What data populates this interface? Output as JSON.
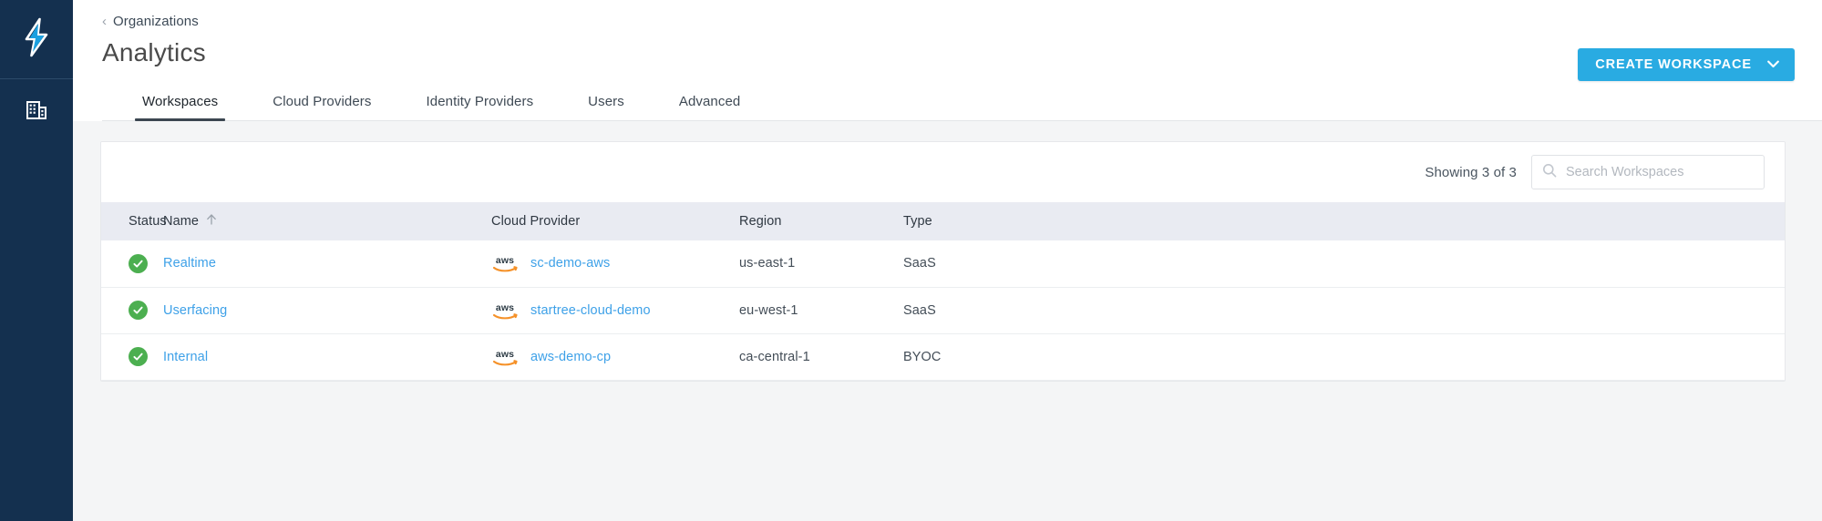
{
  "sidebar": {
    "logo_icon": "startree-lightning-bolt-logo",
    "items": [
      {
        "icon": "organization-building-icon",
        "label": "Organizations"
      }
    ]
  },
  "header": {
    "breadcrumb": {
      "icon": "chevron-left-icon",
      "label": "Organizations"
    },
    "title": "Analytics",
    "create_button": {
      "label": "CREATE WORKSPACE",
      "icon": "chevron-down-icon",
      "color": "#29ABE2"
    }
  },
  "tabs": [
    {
      "label": "Workspaces",
      "active": true
    },
    {
      "label": "Cloud Providers",
      "active": false
    },
    {
      "label": "Identity Providers",
      "active": false
    },
    {
      "label": "Users",
      "active": false
    },
    {
      "label": "Advanced",
      "active": false
    }
  ],
  "toolbar": {
    "showing_count": "Showing 3 of 3",
    "search": {
      "placeholder": "Search Workspaces",
      "value": "",
      "icon": "search-icon"
    }
  },
  "table": {
    "columns": [
      {
        "key": "status",
        "label": "Status"
      },
      {
        "key": "name",
        "label": "Name",
        "sort": "asc",
        "sort_icon": "arrow-up-icon"
      },
      {
        "key": "cloud_provider",
        "label": "Cloud Provider"
      },
      {
        "key": "region",
        "label": "Region"
      },
      {
        "key": "type",
        "label": "Type"
      }
    ],
    "rows": [
      {
        "status": "healthy",
        "status_icon": "green-check-circle-icon",
        "name": "Realtime",
        "provider_icon": "aws-logo-icon",
        "cloud_provider": "sc-demo-aws",
        "region": "us-east-1",
        "type": "SaaS"
      },
      {
        "status": "healthy",
        "status_icon": "green-check-circle-icon",
        "name": "Userfacing",
        "provider_icon": "aws-logo-icon",
        "cloud_provider": "startree-cloud-demo",
        "region": "eu-west-1",
        "type": "SaaS"
      },
      {
        "status": "healthy",
        "status_icon": "green-check-circle-icon",
        "name": "Internal",
        "provider_icon": "aws-logo-icon",
        "cloud_provider": "aws-demo-cp",
        "region": "ca-central-1",
        "type": "BYOC"
      }
    ]
  },
  "colors": {
    "sidebar_bg": "#14304f",
    "accent_blue": "#29ABE2",
    "link_blue": "#3ea1e8",
    "status_green": "#4caf50",
    "table_header_bg": "#e9ebf2",
    "page_bg": "#f4f5f6",
    "aws_orange": "#f59128"
  }
}
